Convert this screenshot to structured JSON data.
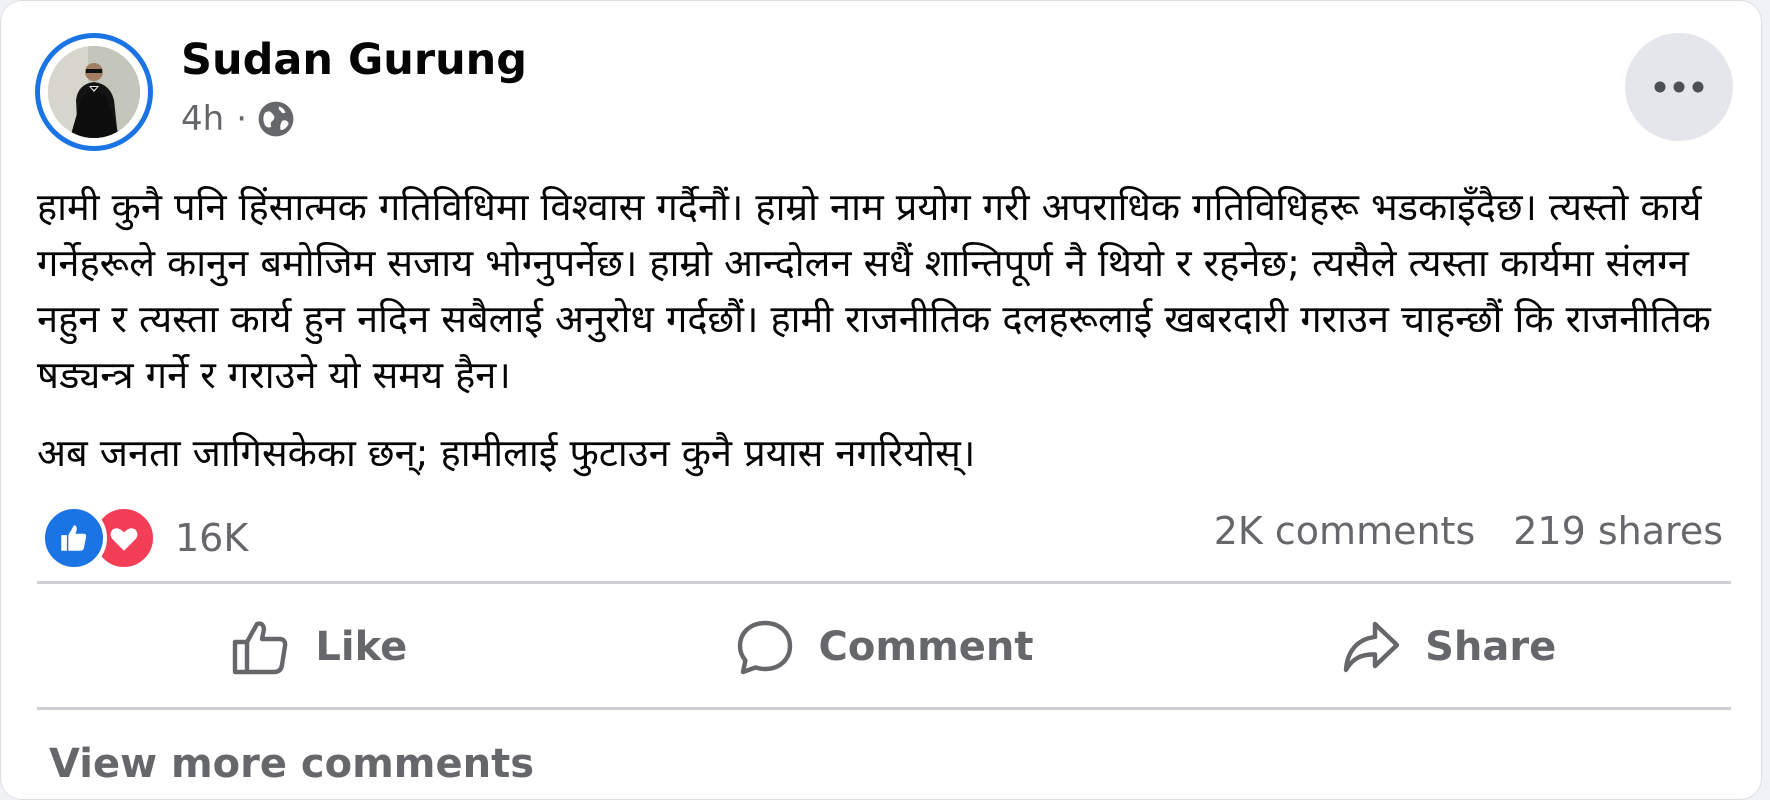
{
  "post": {
    "author": "Sudan Gurung",
    "time": "4h",
    "separator": "·",
    "visibility_icon": "globe-icon",
    "more_icon": "more-options-icon",
    "paragraphs": [
      "हामी कुनै पनि हिंसात्मक गतिविधिमा विश्वास गर्दैनौं। हाम्रो नाम प्रयोग गरी अपराधिक गतिविधिहरू भडकाइँदैछ। त्यस्तो कार्य गर्नेहरूले कानुन बमोजिम सजाय भोग्नुपर्नेछ। हाम्रो आन्दोलन सधैं शान्तिपूर्ण नै थियो र रहनेछ; त्यसैले त्यस्ता कार्यमा संलग्न नहुन र त्यस्ता कार्य हुन नदिन सबैलाई अनुरोध गर्दछौं। हामी राजनीतिक दलहरूलाई खबरदारी गराउन चाहन्छौं कि राजनीतिक षड्यन्त्र गर्ने र गराउने यो समय हैन।",
      "अब जनता जागिसकेका छन्; हामीलाई फुटाउन कुनै प्रयास नगरियोस्।"
    ]
  },
  "stats": {
    "reaction_count": "16K",
    "reactions": [
      "like",
      "love"
    ],
    "comments": "2K comments",
    "shares": "219 shares"
  },
  "actions": {
    "like_label": "Like",
    "comment_label": "Comment",
    "share_label": "Share"
  },
  "footer": {
    "view_more_comments": "View more comments"
  },
  "colors": {
    "brand_blue": "#1b74e4",
    "love_red": "#f33e58",
    "secondary_text": "#65676b",
    "primary_text": "#050505"
  }
}
